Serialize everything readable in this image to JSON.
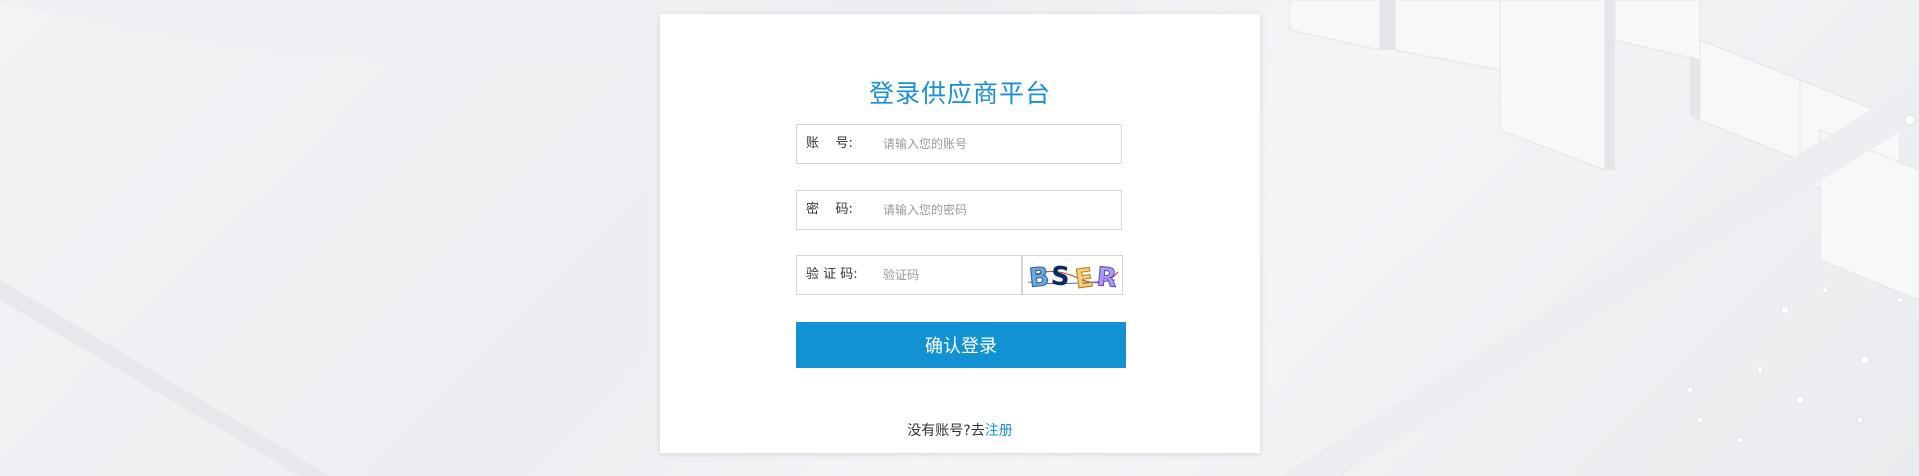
{
  "login": {
    "title": "登录供应商平台",
    "account": {
      "label": "账    号:",
      "placeholder": "请输入您的账号",
      "value": ""
    },
    "password": {
      "label": "密    码:",
      "placeholder": "请输入您的密码",
      "value": ""
    },
    "captcha": {
      "label": "验 证 码:",
      "placeholder": "验证码",
      "value": "",
      "image_text": "BSER"
    },
    "submit_label": "确认登录",
    "register_prompt": "没有账号?去",
    "register_link": "注册"
  },
  "colors": {
    "accent": "#1292d3",
    "title": "#1a8fd8",
    "link": "#1a8fd8"
  }
}
